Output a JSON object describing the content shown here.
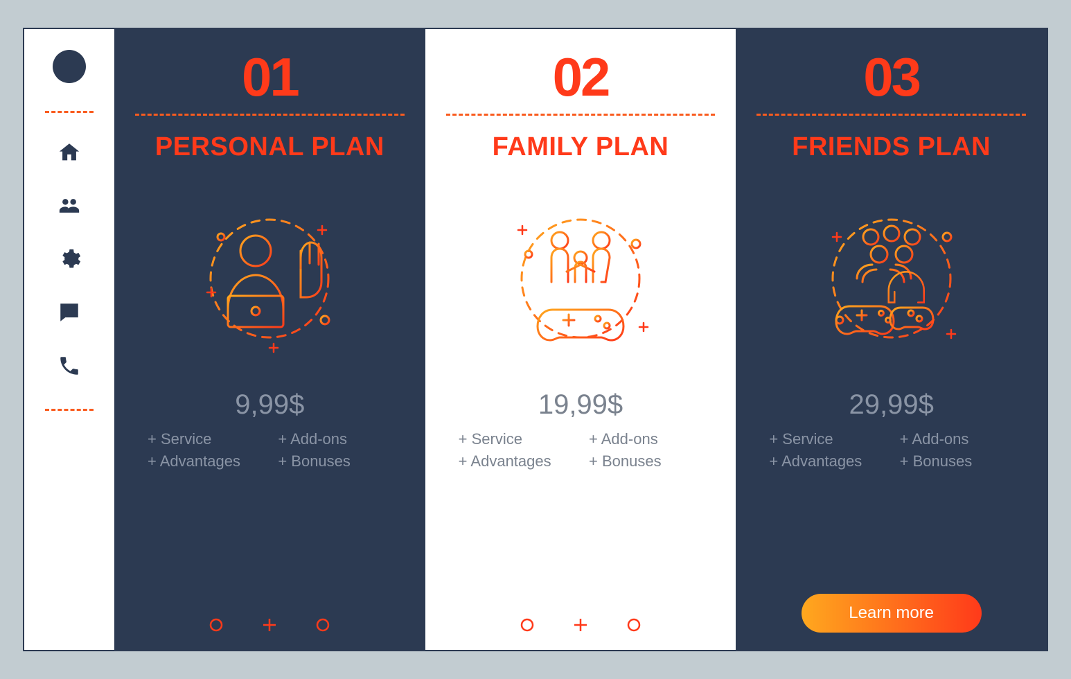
{
  "sidebar": {
    "icons": [
      "home-icon",
      "users-icon",
      "gear-icon",
      "chat-icon",
      "phone-icon"
    ]
  },
  "plans": [
    {
      "number": "01",
      "title": "PERSONAL PLAN",
      "price": "9,99$",
      "features": [
        "+ Service",
        "+ Add-ons",
        "+ Advantages",
        "+ Bonuses"
      ],
      "illustration": "person-laptop-hand-icon",
      "theme": "dark"
    },
    {
      "number": "02",
      "title": "FAMILY PLAN",
      "price": "19,99$",
      "features": [
        "+ Service",
        "+ Add-ons",
        "+ Advantages",
        "+ Bonuses"
      ],
      "illustration": "family-gamepad-icon",
      "theme": "light"
    },
    {
      "number": "03",
      "title": "FRIENDS PLAN",
      "price": "29,99$",
      "features": [
        "+ Service",
        "+ Add-ons",
        "+ Advantages",
        "+ Bonuses"
      ],
      "illustration": "friends-gaming-icon",
      "theme": "dark"
    }
  ],
  "cta": {
    "label": "Learn more"
  },
  "colors": {
    "bg": "#c2ccd1",
    "dark": "#2c3a52",
    "accent": "#ff3a1a",
    "accent2": "#ffa81e"
  }
}
